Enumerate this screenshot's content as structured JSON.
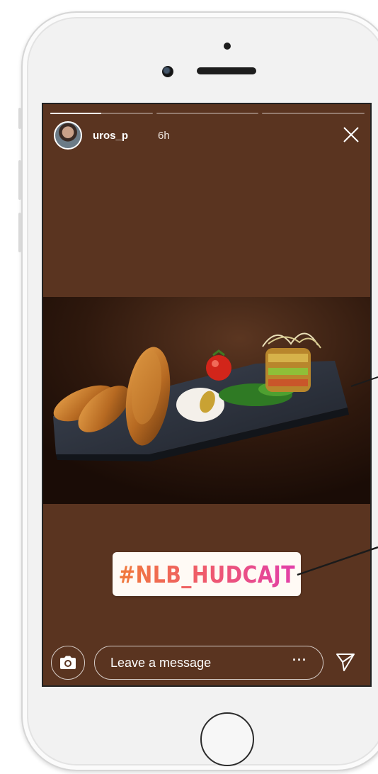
{
  "story": {
    "username": "uros_p",
    "time_ago": "6h",
    "segments": [
      {
        "progress": 0.5
      },
      {
        "progress": 0
      },
      {
        "progress": 0
      }
    ],
    "hashtag": "#NLB_HUDCAJT",
    "message_placeholder": "Leave a message",
    "more_label": "···"
  },
  "icons": {
    "close": "close-icon",
    "camera": "camera-icon",
    "send": "paper-plane-icon"
  },
  "colors": {
    "story_background": "#5a3420",
    "hashtag_gradient_start": "#f07a3a",
    "hashtag_gradient_end": "#e23fa8"
  }
}
